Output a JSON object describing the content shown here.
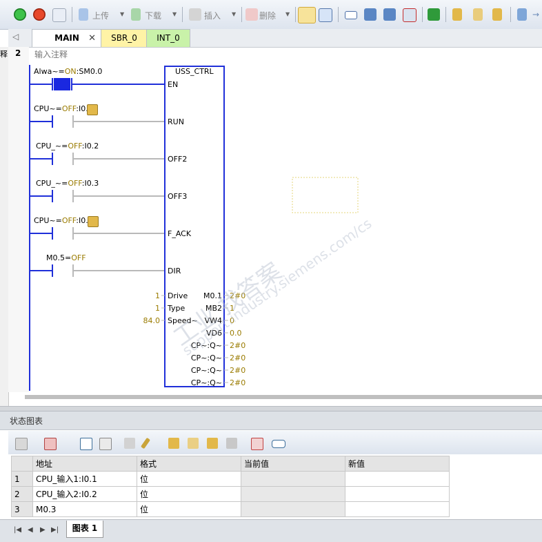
{
  "toolbar": {
    "upload_label": "上传",
    "download_label": "下载",
    "insert_label": "插入",
    "delete_label": "删除",
    "icons": [
      "run-icon",
      "stop-icon",
      "compile-icon",
      "upload-icon",
      "download-icon",
      "insert-icon",
      "delete-icon",
      "monitor-icon",
      "monitor-status-icon",
      "box-icon",
      "arrow-left-icon",
      "arrow-right-icon",
      "clear-icon",
      "jump-icon",
      "lock-icon",
      "unlock-icon",
      "force-icon",
      "branch-icon"
    ]
  },
  "tabs": [
    {
      "label": "MAIN",
      "close": "✕"
    },
    {
      "label": "SBR_0"
    },
    {
      "label": "INT_0"
    }
  ],
  "editor": {
    "gutter_char": "释",
    "rung_number": "2",
    "comment": "输入注释",
    "contacts": [
      {
        "name": "Alwa~",
        "eq": "=",
        "state": "ON",
        "addr": ":SM0.0"
      },
      {
        "name": "CPU~",
        "eq": "=",
        "state": "OFF",
        "addr": ":I0.1"
      },
      {
        "name": "CPU_~",
        "eq": "=",
        "state": "OFF",
        "addr": ":I0.2"
      },
      {
        "name": "CPU_~",
        "eq": "=",
        "state": "OFF",
        "addr": ":I0.3"
      },
      {
        "name": "CPU~",
        "eq": "=",
        "state": "OFF",
        "addr": ":I0.4"
      },
      {
        "name": "M0.5",
        "eq": "=",
        "state": "OFF",
        "addr": ""
      }
    ],
    "block": {
      "title": "USS_CTRL",
      "inputs": [
        "EN",
        "RUN",
        "OFF2",
        "OFF3",
        "F_ACK",
        "DIR"
      ],
      "params": [
        {
          "value": "1",
          "pin": "Drive"
        },
        {
          "value": "1",
          "pin": "Type"
        },
        {
          "value": "84.0",
          "pin": "Speed~"
        }
      ],
      "outputs": [
        {
          "pin": "M0.1",
          "value": "2#0"
        },
        {
          "pin": "MB2",
          "value": "1"
        },
        {
          "pin": "VW4",
          "value": "0"
        },
        {
          "pin": "VD6",
          "value": "0.0"
        },
        {
          "pin": "CP~:Q~",
          "value": "2#0"
        },
        {
          "pin": "CP~:Q~",
          "value": "2#0"
        },
        {
          "pin": "CP~:Q~",
          "value": "2#0"
        },
        {
          "pin": "CP~:Q~",
          "value": "2#0"
        }
      ]
    },
    "watermark_1": "工业   找答案",
    "watermark_2": "support.industry.siemens.com/cs"
  },
  "status_chart": {
    "title": "状态图表",
    "columns": [
      "地址",
      "格式",
      "当前值",
      "新值"
    ],
    "rows": [
      {
        "n": "1",
        "addr": "CPU_输入1:I0.1",
        "fmt": "位",
        "cur": "",
        "new": ""
      },
      {
        "n": "2",
        "addr": "CPU_输入2:I0.2",
        "fmt": "位",
        "cur": "",
        "new": ""
      },
      {
        "n": "3",
        "addr": "M0.3",
        "fmt": "位",
        "cur": "",
        "new": ""
      }
    ],
    "sheet_tab": "图表 1"
  },
  "colors": {
    "rail": "#1f2fd9",
    "inactive": "#b9b9b9",
    "powerflow": "#1a28e0",
    "olive": "#9a7b00"
  }
}
